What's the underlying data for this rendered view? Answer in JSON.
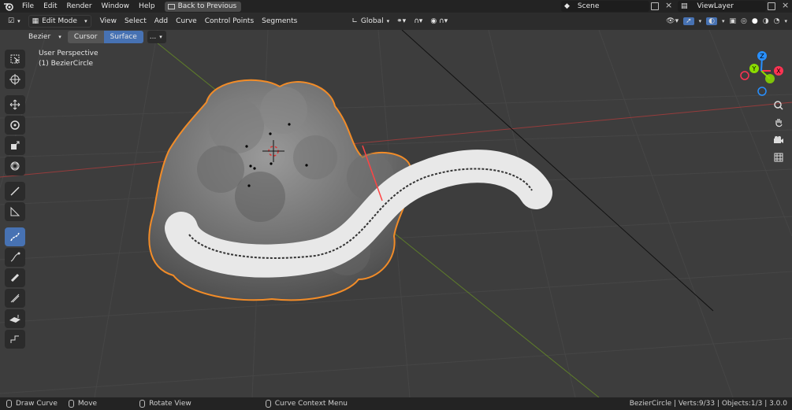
{
  "menu": {
    "items": [
      "File",
      "Edit",
      "Render",
      "Window",
      "Help"
    ],
    "back_button": "Back to Previous"
  },
  "scene": {
    "label": "Scene"
  },
  "view_layer": {
    "label": "ViewLayer"
  },
  "toolbar": {
    "mode": "Edit Mode",
    "menus": [
      "View",
      "Select",
      "Add",
      "Curve",
      "Control Points",
      "Segments"
    ],
    "transform_orientation": "Global"
  },
  "tool_header": {
    "curve_type": "Bezier",
    "depth_cursor": "Cursor",
    "depth_surface": "Surface",
    "more": "..."
  },
  "overlay_info": {
    "perspective": "User Perspective",
    "object": "(1) BezierCircle"
  },
  "gizmo": {
    "x": "X",
    "y": "Y",
    "z": "Z"
  },
  "status": {
    "left_action": "Draw Curve",
    "middle_action": "Move",
    "rotate": "Rotate View",
    "context": "Curve Context Menu",
    "stats": "BezierCircle | Verts:9/33 | Objects:1/3 | 3.0.0"
  },
  "colors": {
    "accent": "#4772b3",
    "selection_outline": "#f28c28",
    "axis_x": "#ff3352",
    "axis_y": "#8bdc00",
    "axis_z": "#2890ff"
  }
}
